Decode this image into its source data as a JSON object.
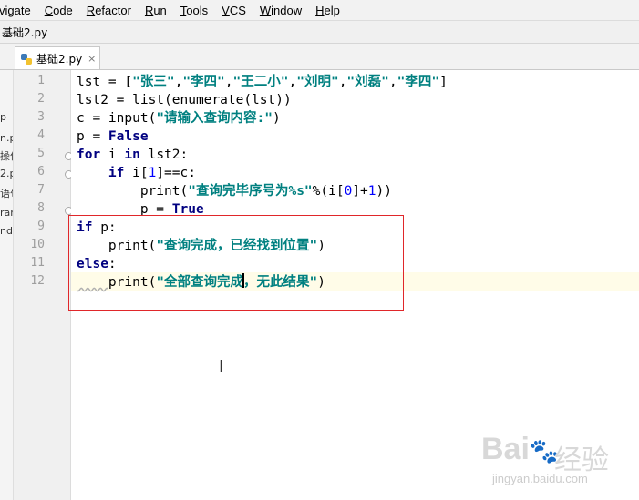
{
  "menu": [
    {
      "pre": "",
      "u": "",
      "post": "vigate"
    },
    {
      "pre": "",
      "u": "C",
      "post": "ode"
    },
    {
      "pre": "",
      "u": "R",
      "post": "efactor"
    },
    {
      "pre": "",
      "u": "R",
      "post": "un"
    },
    {
      "pre": "",
      "u": "T",
      "post": "ools"
    },
    {
      "pre": "",
      "u": "V",
      "post": "CS"
    },
    {
      "pre": "",
      "u": "W",
      "post": "indow"
    },
    {
      "pre": "",
      "u": "H",
      "post": "elp"
    }
  ],
  "breadcrumb": "基础2.py",
  "tab": {
    "name": "基础2.py",
    "close": "×"
  },
  "project_fragments": [
    "p",
    "n.p",
    "操作",
    "2.py",
    "语句",
    "rar",
    "nd"
  ],
  "line_numbers": [
    "1",
    "2",
    "3",
    "4",
    "5",
    "6",
    "7",
    "8",
    "9",
    "10",
    "11",
    "12"
  ],
  "code": {
    "l1": {
      "a": "lst = [",
      "s1": "\"张三\"",
      "c1": ",",
      "s2": "\"李四\"",
      "c2": ",",
      "s3": "\"王二小\"",
      "c3": ",",
      "s4": "\"刘明\"",
      "c4": ",",
      "s5": "\"刘磊\"",
      "c5": ",",
      "s6": "\"李四\"",
      "e": "]"
    },
    "l2": "lst2 = list(enumerate(lst))",
    "l3": {
      "a": "c = input(",
      "s": "\"请输入查询内容:\"",
      "e": ")"
    },
    "l4": {
      "a": "p = ",
      "k": "False"
    },
    "l5": {
      "k1": "for",
      "a": " i ",
      "k2": "in",
      "e": " lst2:"
    },
    "l6": {
      "ind": "    ",
      "k": "if",
      "a": " i[",
      "n": "1",
      "e": "]==c:"
    },
    "l7": {
      "ind": "        ",
      "a": "print(",
      "s": "\"查询完毕序号为%s\"",
      "b": "%(i[",
      "n1": "0",
      "c": "]+",
      "n2": "1",
      "e": "))"
    },
    "l8": {
      "ind": "        ",
      "a": "p = ",
      "k": "True"
    },
    "l9": {
      "k": "if",
      "e": " p:"
    },
    "l10": {
      "ind": "    ",
      "a": "print(",
      "s": "\"查询完成，已经找到位置\"",
      "e": ")"
    },
    "l11": {
      "k": "else",
      "e": ":"
    },
    "l12": {
      "ind": "    ",
      "a": "print(",
      "s1": "\"全部查询完成",
      "s2": "，无此结果\"",
      "e": ")"
    }
  },
  "colors": {
    "keyword": "#000080",
    "string": "#008080",
    "number": "#0000ff",
    "highlight_box": "#e0272a",
    "current_line": "#fffce8"
  },
  "watermark": {
    "logo": "Bai",
    "paw": "du",
    "brand": "经验",
    "site": "jingyan.baidu.com"
  }
}
